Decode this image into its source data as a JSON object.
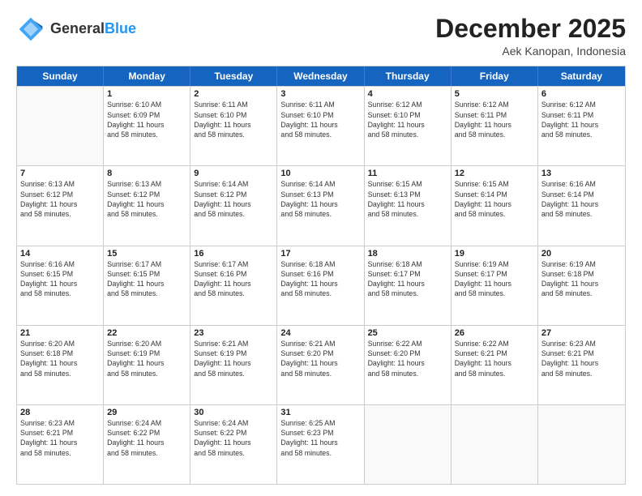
{
  "header": {
    "logo_general": "General",
    "logo_blue": "Blue",
    "month_title": "December 2025",
    "location": "Aek Kanopan, Indonesia"
  },
  "days_of_week": [
    "Sunday",
    "Monday",
    "Tuesday",
    "Wednesday",
    "Thursday",
    "Friday",
    "Saturday"
  ],
  "weeks": [
    [
      {
        "day": "",
        "empty": true
      },
      {
        "day": "1",
        "sunrise": "6:10 AM",
        "sunset": "6:09 PM",
        "daylight": "11 hours and 58 minutes."
      },
      {
        "day": "2",
        "sunrise": "6:11 AM",
        "sunset": "6:10 PM",
        "daylight": "11 hours and 58 minutes."
      },
      {
        "day": "3",
        "sunrise": "6:11 AM",
        "sunset": "6:10 PM",
        "daylight": "11 hours and 58 minutes."
      },
      {
        "day": "4",
        "sunrise": "6:12 AM",
        "sunset": "6:10 PM",
        "daylight": "11 hours and 58 minutes."
      },
      {
        "day": "5",
        "sunrise": "6:12 AM",
        "sunset": "6:11 PM",
        "daylight": "11 hours and 58 minutes."
      },
      {
        "day": "6",
        "sunrise": "6:12 AM",
        "sunset": "6:11 PM",
        "daylight": "11 hours and 58 minutes."
      }
    ],
    [
      {
        "day": "7",
        "sunrise": "6:13 AM",
        "sunset": "6:12 PM",
        "daylight": "11 hours and 58 minutes."
      },
      {
        "day": "8",
        "sunrise": "6:13 AM",
        "sunset": "6:12 PM",
        "daylight": "11 hours and 58 minutes."
      },
      {
        "day": "9",
        "sunrise": "6:14 AM",
        "sunset": "6:12 PM",
        "daylight": "11 hours and 58 minutes."
      },
      {
        "day": "10",
        "sunrise": "6:14 AM",
        "sunset": "6:13 PM",
        "daylight": "11 hours and 58 minutes."
      },
      {
        "day": "11",
        "sunrise": "6:15 AM",
        "sunset": "6:13 PM",
        "daylight": "11 hours and 58 minutes."
      },
      {
        "day": "12",
        "sunrise": "6:15 AM",
        "sunset": "6:14 PM",
        "daylight": "11 hours and 58 minutes."
      },
      {
        "day": "13",
        "sunrise": "6:16 AM",
        "sunset": "6:14 PM",
        "daylight": "11 hours and 58 minutes."
      }
    ],
    [
      {
        "day": "14",
        "sunrise": "6:16 AM",
        "sunset": "6:15 PM",
        "daylight": "11 hours and 58 minutes."
      },
      {
        "day": "15",
        "sunrise": "6:17 AM",
        "sunset": "6:15 PM",
        "daylight": "11 hours and 58 minutes."
      },
      {
        "day": "16",
        "sunrise": "6:17 AM",
        "sunset": "6:16 PM",
        "daylight": "11 hours and 58 minutes."
      },
      {
        "day": "17",
        "sunrise": "6:18 AM",
        "sunset": "6:16 PM",
        "daylight": "11 hours and 58 minutes."
      },
      {
        "day": "18",
        "sunrise": "6:18 AM",
        "sunset": "6:17 PM",
        "daylight": "11 hours and 58 minutes."
      },
      {
        "day": "19",
        "sunrise": "6:19 AM",
        "sunset": "6:17 PM",
        "daylight": "11 hours and 58 minutes."
      },
      {
        "day": "20",
        "sunrise": "6:19 AM",
        "sunset": "6:18 PM",
        "daylight": "11 hours and 58 minutes."
      }
    ],
    [
      {
        "day": "21",
        "sunrise": "6:20 AM",
        "sunset": "6:18 PM",
        "daylight": "11 hours and 58 minutes."
      },
      {
        "day": "22",
        "sunrise": "6:20 AM",
        "sunset": "6:19 PM",
        "daylight": "11 hours and 58 minutes."
      },
      {
        "day": "23",
        "sunrise": "6:21 AM",
        "sunset": "6:19 PM",
        "daylight": "11 hours and 58 minutes."
      },
      {
        "day": "24",
        "sunrise": "6:21 AM",
        "sunset": "6:20 PM",
        "daylight": "11 hours and 58 minutes."
      },
      {
        "day": "25",
        "sunrise": "6:22 AM",
        "sunset": "6:20 PM",
        "daylight": "11 hours and 58 minutes."
      },
      {
        "day": "26",
        "sunrise": "6:22 AM",
        "sunset": "6:21 PM",
        "daylight": "11 hours and 58 minutes."
      },
      {
        "day": "27",
        "sunrise": "6:23 AM",
        "sunset": "6:21 PM",
        "daylight": "11 hours and 58 minutes."
      }
    ],
    [
      {
        "day": "28",
        "sunrise": "6:23 AM",
        "sunset": "6:21 PM",
        "daylight": "11 hours and 58 minutes."
      },
      {
        "day": "29",
        "sunrise": "6:24 AM",
        "sunset": "6:22 PM",
        "daylight": "11 hours and 58 minutes."
      },
      {
        "day": "30",
        "sunrise": "6:24 AM",
        "sunset": "6:22 PM",
        "daylight": "11 hours and 58 minutes."
      },
      {
        "day": "31",
        "sunrise": "6:25 AM",
        "sunset": "6:23 PM",
        "daylight": "11 hours and 58 minutes."
      },
      {
        "day": "",
        "empty": true
      },
      {
        "day": "",
        "empty": true
      },
      {
        "day": "",
        "empty": true
      }
    ]
  ]
}
